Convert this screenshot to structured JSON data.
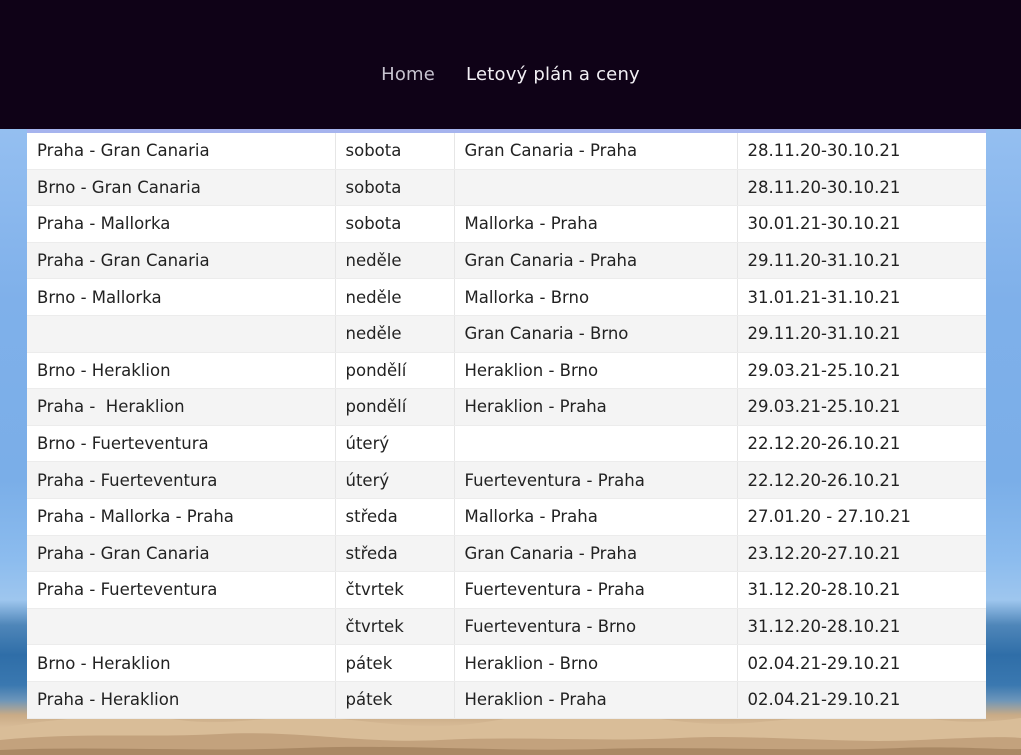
{
  "nav": {
    "items": [
      {
        "label": "Home"
      },
      {
        "label": "Letový plán a ceny"
      }
    ]
  },
  "schedule": {
    "rows": [
      [
        "Praha - Gran Canaria",
        "sobota",
        "Gran Canaria - Praha",
        "28.11.20-30.10.21"
      ],
      [
        "Brno - Gran Canaria",
        "sobota",
        "",
        "28.11.20-30.10.21"
      ],
      [
        "Praha - Mallorka",
        "sobota",
        "Mallorka - Praha",
        "30.01.21-30.10.21"
      ],
      [
        "Praha - Gran Canaria",
        "neděle",
        "Gran Canaria - Praha",
        "29.11.20-31.10.21"
      ],
      [
        "Brno - Mallorka",
        "neděle",
        "Mallorka - Brno",
        "31.01.21-31.10.21"
      ],
      [
        "",
        "neděle",
        "Gran Canaria - Brno",
        "29.11.20-31.10.21"
      ],
      [
        "Brno - Heraklion",
        "pondělí",
        "Heraklion - Brno",
        "29.03.21-25.10.21"
      ],
      [
        "Praha -  Heraklion",
        "pondělí",
        "Heraklion - Praha",
        "29.03.21-25.10.21"
      ],
      [
        "Brno - Fuerteventura",
        "úterý",
        "",
        "22.12.20-26.10.21"
      ],
      [
        "Praha - Fuerteventura",
        "úterý",
        "Fuerteventura - Praha",
        "22.12.20-26.10.21"
      ],
      [
        "Praha - Mallorka - Praha",
        "středa",
        "Mallorka - Praha",
        "27.01.20 - 27.10.21"
      ],
      [
        "Praha - Gran Canaria",
        "středa",
        "Gran Canaria - Praha",
        "23.12.20-27.10.21"
      ],
      [
        "Praha - Fuerteventura",
        "čtvrtek",
        "Fuerteventura - Praha",
        "31.12.20-28.10.21"
      ],
      [
        "",
        "čtvrtek",
        "Fuerteventura - Brno",
        "31.12.20-28.10.21"
      ],
      [
        "Brno - Heraklion",
        "pátek",
        "Heraklion - Brno",
        "02.04.21-29.10.21"
      ],
      [
        "Praha - Heraklion",
        "pátek",
        "Heraklion - Praha",
        "02.04.21-29.10.21"
      ]
    ]
  }
}
